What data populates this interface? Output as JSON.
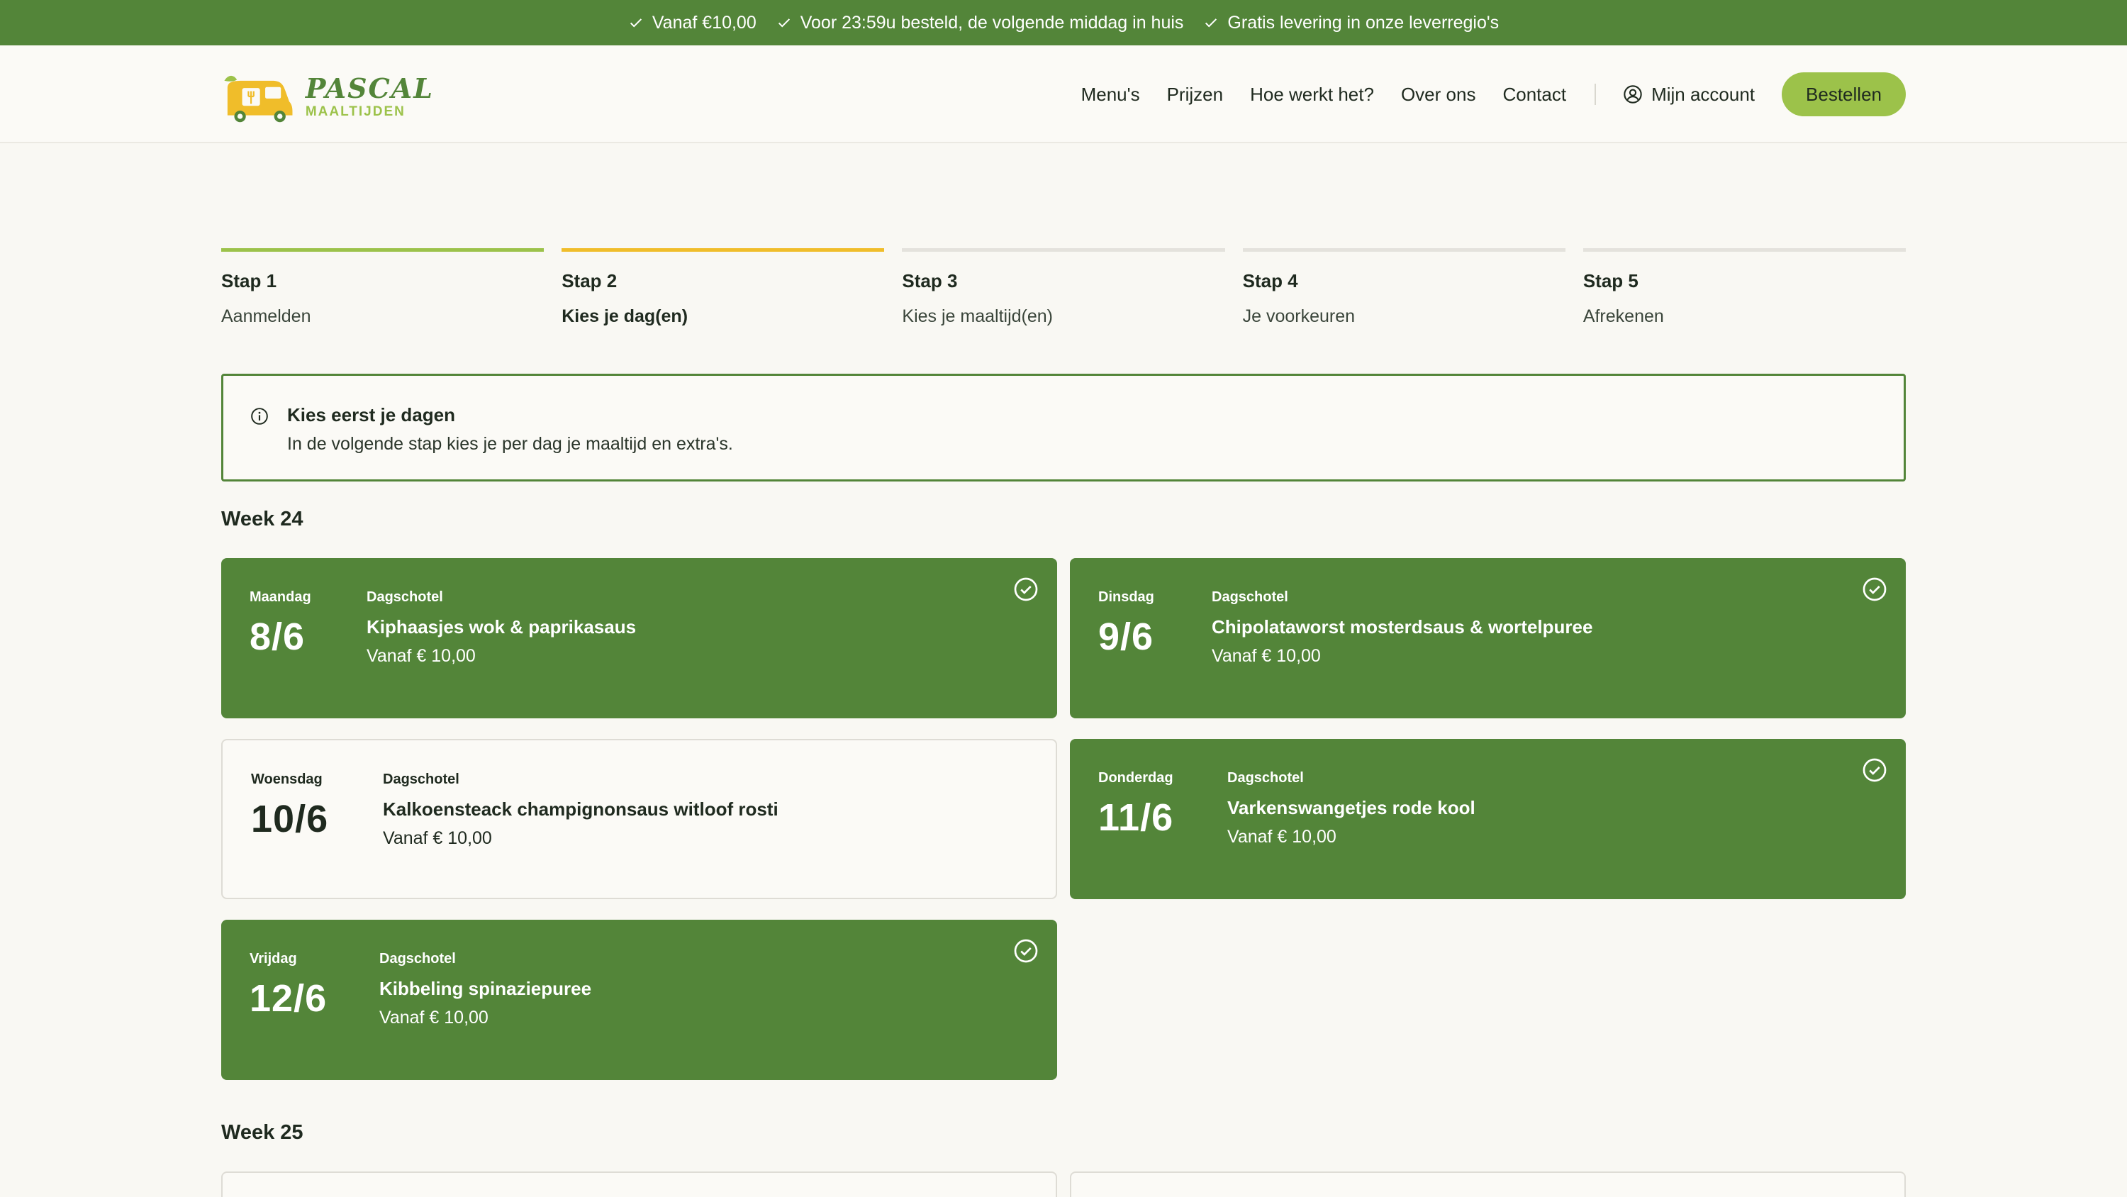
{
  "topbar": {
    "usps": [
      "Vanaf €10,00",
      "Voor 23:59u besteld, de volgende middag in huis",
      "Gratis levering in onze leverregio's"
    ]
  },
  "logo": {
    "brand": "PASCAL",
    "sub": "MAALTIJDEN"
  },
  "nav": {
    "links": [
      "Menu's",
      "Prijzen",
      "Hoe werkt het?",
      "Over ons",
      "Contact"
    ],
    "account": "Mijn account",
    "order": "Bestellen"
  },
  "steps": [
    {
      "num": "Stap 1",
      "label": "Aanmelden"
    },
    {
      "num": "Stap 2",
      "label": "Kies je dag(en)"
    },
    {
      "num": "Stap 3",
      "label": "Kies je maaltijd(en)"
    },
    {
      "num": "Stap 4",
      "label": "Je voorkeuren"
    },
    {
      "num": "Stap 5",
      "label": "Afrekenen"
    }
  ],
  "info": {
    "title": "Kies eerst je dagen",
    "text": "In de volgende stap kies je per dag je maaltijd en extra's."
  },
  "weeks": [
    {
      "title": "Week 24",
      "days": [
        {
          "day": "Maandag",
          "date": "8/6",
          "kind": "Dagschotel",
          "meal": "Kiphaasjes wok & paprikasaus",
          "price": "Vanaf € 10,00",
          "selected": true
        },
        {
          "day": "Dinsdag",
          "date": "9/6",
          "kind": "Dagschotel",
          "meal": "Chipolataworst mosterdsaus & wortelpuree",
          "price": "Vanaf € 10,00",
          "selected": true
        },
        {
          "day": "Woensdag",
          "date": "10/6",
          "kind": "Dagschotel",
          "meal": "Kalkoensteack champignonsaus witloof rosti",
          "price": "Vanaf € 10,00",
          "selected": false
        },
        {
          "day": "Donderdag",
          "date": "11/6",
          "kind": "Dagschotel",
          "meal": "Varkenswangetjes rode kool",
          "price": "Vanaf € 10,00",
          "selected": true
        },
        {
          "day": "Vrijdag",
          "date": "12/6",
          "kind": "Dagschotel",
          "meal": "Kibbeling spinaziepuree",
          "price": "Vanaf € 10,00",
          "selected": true
        }
      ]
    },
    {
      "title": "Week 25"
    }
  ],
  "colors": {
    "brand_green": "#538539",
    "light_green": "#9cc24a",
    "accent_yellow": "#f0bd2a",
    "background": "#f9f8f3"
  }
}
